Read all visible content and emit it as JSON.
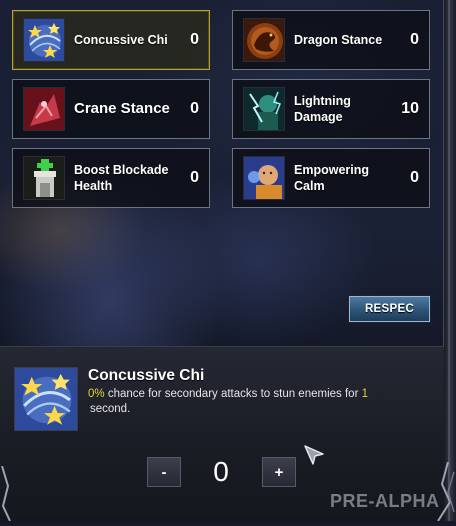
{
  "skills": [
    {
      "name": "Concussive Chi",
      "value": "0",
      "icon": "chi-stars-icon",
      "selected": true
    },
    {
      "name": "Dragon Stance",
      "value": "0",
      "icon": "dragon-emblem-icon",
      "selected": false
    },
    {
      "name": "Crane Stance",
      "value": "0",
      "icon": "crane-stance-icon",
      "selected": false
    },
    {
      "name": "Lightning Damage",
      "value": "10",
      "icon": "lightning-monk-icon",
      "selected": false
    },
    {
      "name": "Boost Blockade Health",
      "value": "0",
      "icon": "blockade-tower-icon",
      "selected": false
    },
    {
      "name": "Empowering Calm",
      "value": "0",
      "icon": "meditating-monk-icon",
      "selected": false
    }
  ],
  "respec_label": "RESPEC",
  "detail": {
    "title": "Concussive Chi",
    "desc_percent": "0%",
    "desc_middle": " chance for secondary attacks to stun enemies for ",
    "desc_seconds": "1",
    "desc_end": "second."
  },
  "stepper": {
    "minus": "-",
    "value": "0",
    "plus": "+"
  },
  "watermark": "PRE-ALPHA",
  "colors": {
    "selected_border": "#b9a327",
    "highlight": "#e9d33a",
    "button_blue": "#2d5478"
  }
}
